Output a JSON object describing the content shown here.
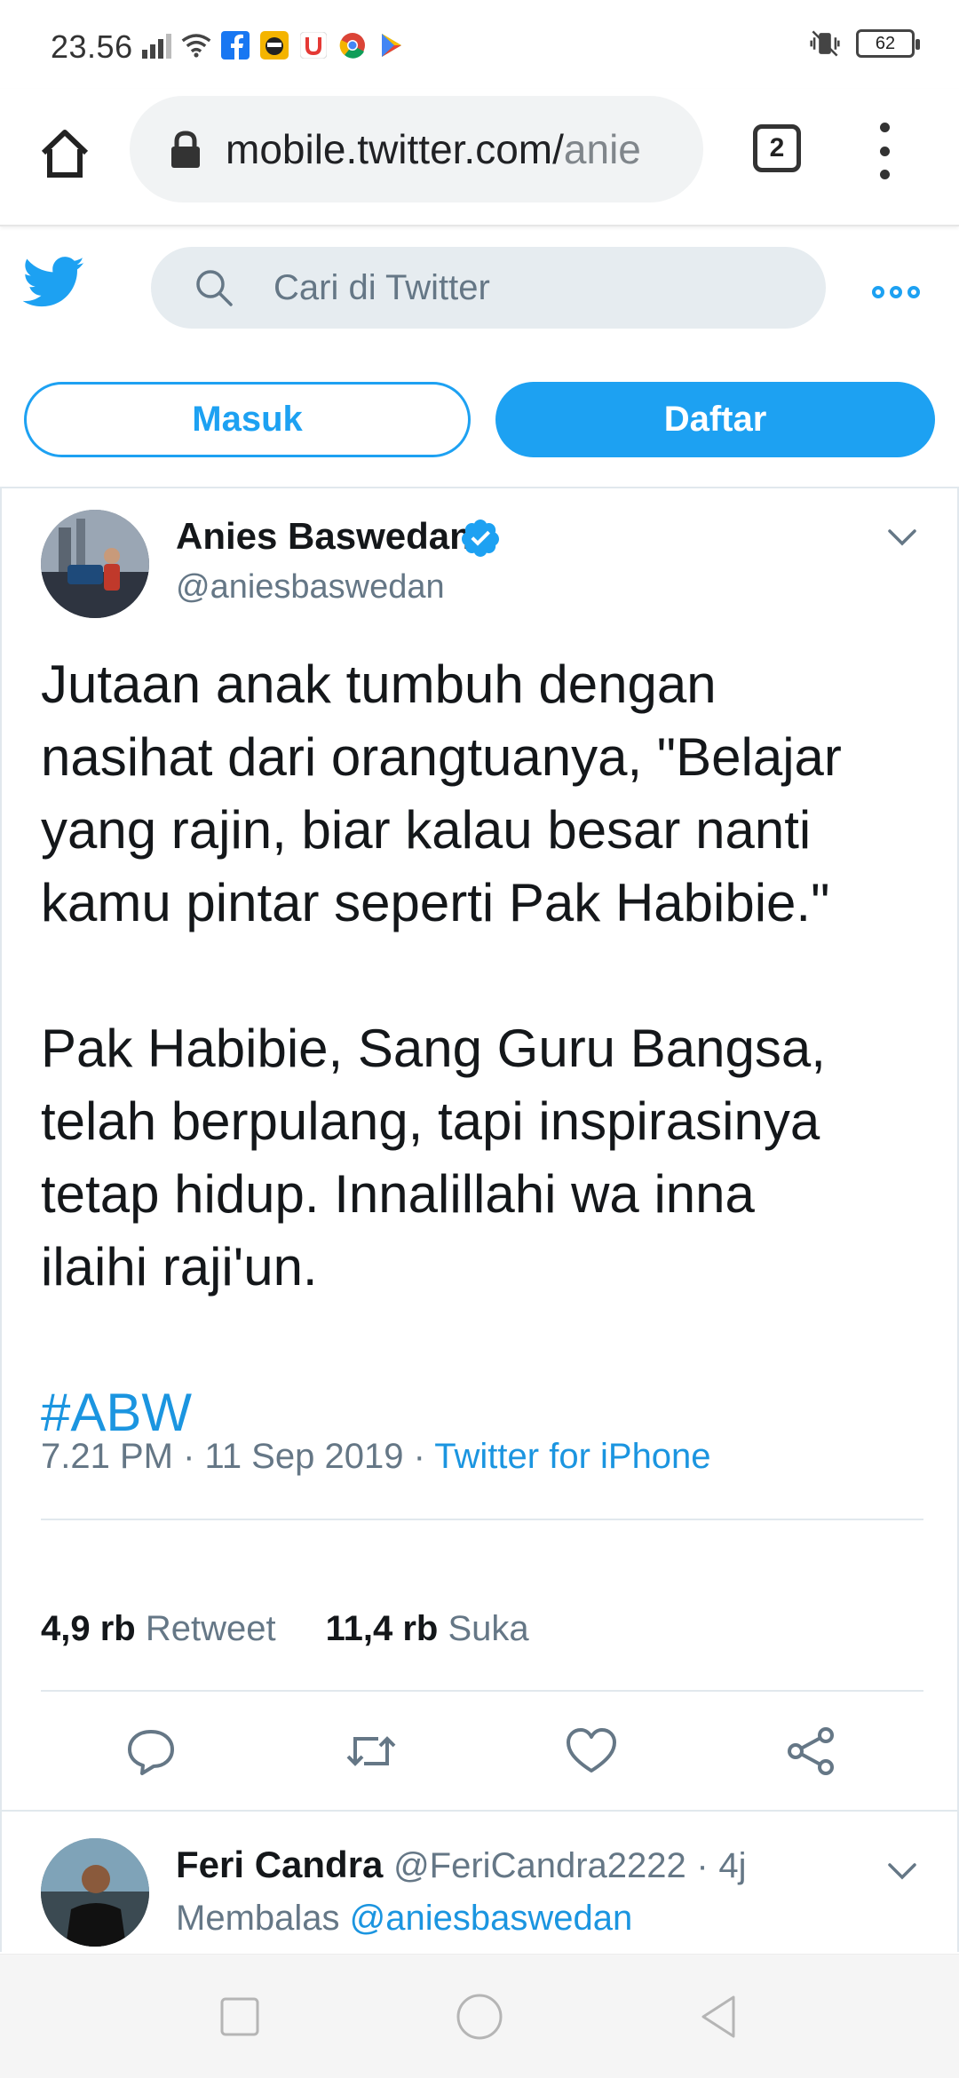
{
  "status_bar": {
    "time": "23.56",
    "battery": "62",
    "icons": [
      "signal-icon",
      "wifi-icon",
      "facebook-icon",
      "app-icon",
      "app-u-icon",
      "chrome-icon",
      "play-store-icon",
      "vibrate-icon",
      "battery-icon"
    ]
  },
  "browser": {
    "url": "mobile.twitter.com/",
    "url_faded": "anie",
    "tab_count": "2"
  },
  "twitter": {
    "search_placeholder": "Cari di Twitter",
    "login_label": "Masuk",
    "signup_label": "Daftar",
    "accent_color": "#1da1f2"
  },
  "tweet": {
    "author_name": "Anies Baswedan",
    "author_handle": "@aniesbaswedan",
    "lines_p1": [
      "Jutaan anak tumbuh dengan",
      "nasihat dari orangtuanya, \"Belajar",
      "yang rajin, biar kalau besar nanti",
      "kamu pintar seperti Pak Habibie.\""
    ],
    "lines_p2": [
      "Pak Habibie, Sang Guru Bangsa,",
      "telah berpulang, tapi inspirasinya",
      "tetap hidup. Innalillahi wa inna",
      "ilaihi raji'un."
    ],
    "hashtag": "#ABW",
    "time": "7.21 PM",
    "separator": "·",
    "date": "11 Sep 2019",
    "source": "Twitter for iPhone",
    "retweet_count": "4,9 rb",
    "retweet_label": "Retweet",
    "like_count": "11,4 rb",
    "like_label": "Suka"
  },
  "reply": {
    "name": "Feri Candra",
    "handle": "@FeriCandra2222",
    "separator": "·",
    "age": "4j",
    "replying_label": "Membalas",
    "replying_to": "@aniesbaswedan"
  }
}
